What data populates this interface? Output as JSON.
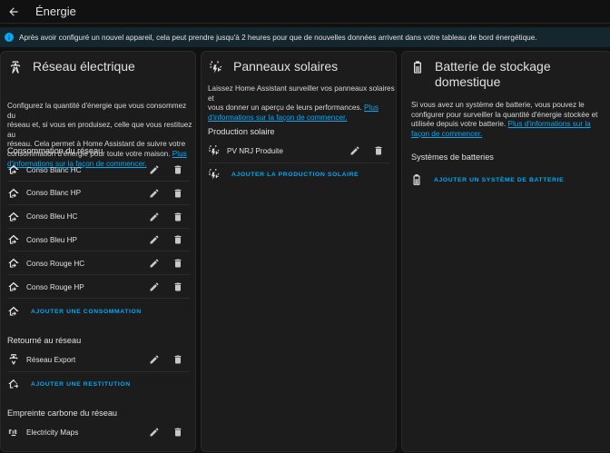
{
  "header": {
    "title": "Énergie"
  },
  "info": {
    "text": "Après avoir configuré un nouvel appareil, cela peut prendre jusqu'à 2 heures pour que de nouvelles données arrivent dans votre tableau de bord énergétique."
  },
  "grid": {
    "title": "Réseau électrique",
    "desc_lines": [
      "Configurez la quantité d'énergie que vous consommez du",
      "réseau et, si vous en produisez, celle que vous restituez au",
      "réseau. Cela permet à Home Assistant de suivre votre",
      "consommation d'énergie pour toute votre maison."
    ],
    "link_a": "Plus",
    "link_b": "d'informations sur la façon de commencer.",
    "consumption_title": "Consommation du réseau",
    "consumption": [
      "Conso Blanc HC",
      "Conso Blanc HP",
      "Conso Bleu HC",
      "Conso Bleu HP",
      "Conso Rouge HC",
      "Conso Rouge HP"
    ],
    "add_consumption": "AJOUTER UNE CONSOMMATION",
    "return_title": "Retourné au réseau",
    "return_item": "Réseau Export",
    "add_return": "AJOUTER UNE RESTITUTION",
    "carbon_title": "Empreinte carbone du réseau",
    "carbon_item": "Electricity Maps"
  },
  "solar": {
    "title": "Panneaux solaires",
    "desc_lines": [
      "Laissez Home Assistant surveiller vos panneaux solaires et",
      "vous donner un aperçu de leurs performances."
    ],
    "link_a": "Plus",
    "link_b": "d'informations sur la façon de commencer.",
    "section_title": "Production solaire",
    "item": "PV NRJ Produite",
    "add": "AJOUTER LA PRODUCTION SOLAIRE"
  },
  "battery": {
    "title_l1": "Batterie de stockage",
    "title_l2": "domestique",
    "desc_lines": [
      "Si vous avez un système de batterie, vous pouvez le",
      "configurer pour surveiller la quantité d'énergie stockée et",
      "utilisée depuis votre batterie."
    ],
    "link_a": "Plus d'informations sur la",
    "link_b": "façon de commencer.",
    "section_title": "Systèmes de batteries",
    "add": "AJOUTER UN SYSTÈME DE BATTERIE"
  },
  "colors": {
    "accent": "#03a9f4",
    "card": "#1c1c1c",
    "background": "#111111",
    "info_bg": "#16262e"
  },
  "icons": {
    "back": "arrow-left-icon",
    "info": "information-icon",
    "grid": "transmission-tower-icon",
    "solar": "solar-power-icon",
    "battery": "battery-icon",
    "home_import": "home-import-icon",
    "tower_export": "transmission-tower-export-icon",
    "home_export": "home-export-icon",
    "leaf": "molecule-co2-icon",
    "edit": "pencil-icon",
    "delete": "delete-icon"
  }
}
